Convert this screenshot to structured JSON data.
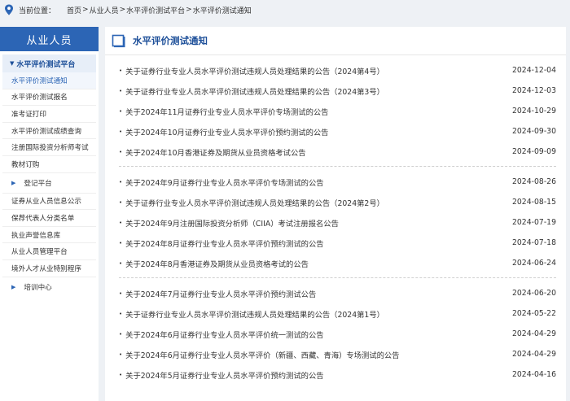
{
  "breadcrumb": {
    "label": "当前位置：",
    "items": [
      "首页",
      "从业人员",
      "水平评价测试平台",
      "水平评价测试通知"
    ],
    "sep": ">"
  },
  "sidebar": {
    "header": "从业人员",
    "section": "水平评价测试平台",
    "section_items": [
      "水平评价测试通知",
      "水平评价测试报名",
      "准考证打印",
      "水平评价测试成绩查询",
      "注册国际投资分析师考试",
      "教材订购"
    ],
    "group1": "登记平台",
    "group1_items": [
      "证券从业人员信息公示",
      "保荐代表人分类名单",
      "执业声誉信息库",
      "从业人员管理平台",
      "境外人才从业特别程序"
    ],
    "group2": "培训中心"
  },
  "main": {
    "title": "水平评价测试通知",
    "groups": [
      [
        {
          "title": "关于证券行业专业人员水平评价测试违规人员处理结果的公告（2024第4号）",
          "date": "2024-12-04"
        },
        {
          "title": "关于证券行业专业人员水平评价测试违规人员处理结果的公告（2024第3号）",
          "date": "2024-12-03"
        },
        {
          "title": "关于2024年11月证券行业专业人员水平评价专场测试的公告",
          "date": "2024-10-29"
        },
        {
          "title": "关于2024年10月证券行业专业人员水平评价预约测试的公告",
          "date": "2024-09-30"
        },
        {
          "title": "关于2024年10月香港证券及期货从业员资格考试公告",
          "date": "2024-09-09"
        }
      ],
      [
        {
          "title": "关于2024年9月证券行业专业人员水平评价专场测试的公告",
          "date": "2024-08-26"
        },
        {
          "title": "关于证券行业专业人员水平评价测试违规人员处理结果的公告（2024第2号）",
          "date": "2024-08-15"
        },
        {
          "title": "关于2024年9月注册国际投资分析师（CIIA）考试注册报名公告",
          "date": "2024-07-19"
        },
        {
          "title": "关于2024年8月证券行业专业人员水平评价预约测试的公告",
          "date": "2024-07-18"
        },
        {
          "title": "关于2024年8月香港证券及期货从业员资格考试的公告",
          "date": "2024-06-24"
        }
      ],
      [
        {
          "title": "关于2024年7月证券行业专业人员水平评价预约测试公告",
          "date": "2024-06-20"
        },
        {
          "title": "关于证券行业专业人员水平评价测试违规人员处理结果的公告（2024第1号）",
          "date": "2024-05-22"
        },
        {
          "title": "关于2024年6月证券行业专业人员水平评价统一测试的公告",
          "date": "2024-04-29"
        },
        {
          "title": "关于2024年6月证券行业专业人员水平评价（新疆、西藏、青海）专场测试的公告",
          "date": "2024-04-29"
        },
        {
          "title": "关于2024年5月证券行业专业人员水平评价预约测试的公告",
          "date": "2024-04-16"
        }
      ]
    ]
  },
  "colors": {
    "accent": "#2c65b5",
    "title_blue": "#1d4f99",
    "background": "#eef1f5"
  },
  "icons": {
    "location": "location-pin-icon",
    "doc": "document-icon"
  }
}
